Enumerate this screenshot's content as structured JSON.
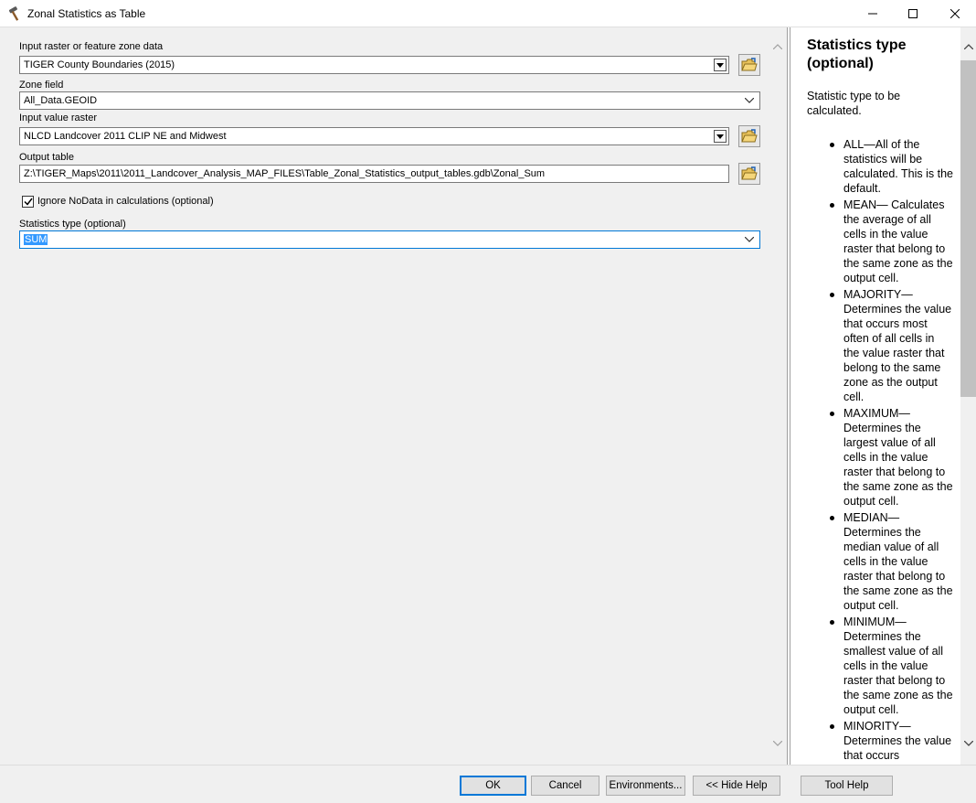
{
  "window": {
    "title": "Zonal Statistics as Table",
    "icon": "hammer-icon"
  },
  "params": {
    "zone_data": {
      "label": "Input raster or feature zone data",
      "value": "TIGER County Boundaries (2015)"
    },
    "zone_field": {
      "label": "Zone field",
      "value": "All_Data.GEOID"
    },
    "value_raster": {
      "label": "Input value raster",
      "value": "NLCD Landcover 2011 CLIP NE and Midwest"
    },
    "output_table": {
      "label": "Output table",
      "value": "Z:\\TIGER_Maps\\2011\\2011_Landcover_Analysis_MAP_FILES\\Table_Zonal_Statistics_output_tables.gdb\\Zonal_Sum"
    },
    "ignore_nodata": {
      "label": "Ignore NoData in calculations (optional)",
      "checked": true
    },
    "statistics_type": {
      "label": "Statistics type (optional)",
      "value": "SUM"
    }
  },
  "help": {
    "title": "Statistics type (optional)",
    "description": "Statistic type to be calculated.",
    "items": [
      "ALL—All of the statistics will be calculated. This is the default.",
      "MEAN— Calculates the average of all cells in the value raster that belong to the same zone as the output cell.",
      "MAJORITY— Determines the value that occurs most often of all cells in the value raster that belong to the same zone as the output cell.",
      "MAXIMUM— Determines the largest value of all cells in the value raster that belong to the same zone as the output cell.",
      "MEDIAN— Determines the median value of all cells in the value raster that belong to the same zone as the output cell.",
      "MINIMUM— Determines the smallest value of all cells in the value raster that belong to the same zone as the output cell.",
      "MINORITY— Determines the value that occurs"
    ]
  },
  "buttons": {
    "ok": "OK",
    "cancel": "Cancel",
    "environments": "Environments...",
    "hide_help": "<< Hide Help",
    "tool_help": "Tool Help"
  },
  "colors": {
    "accent": "#0078d7",
    "selection": "#3399ff",
    "panel_bg": "#f0f0f0"
  }
}
